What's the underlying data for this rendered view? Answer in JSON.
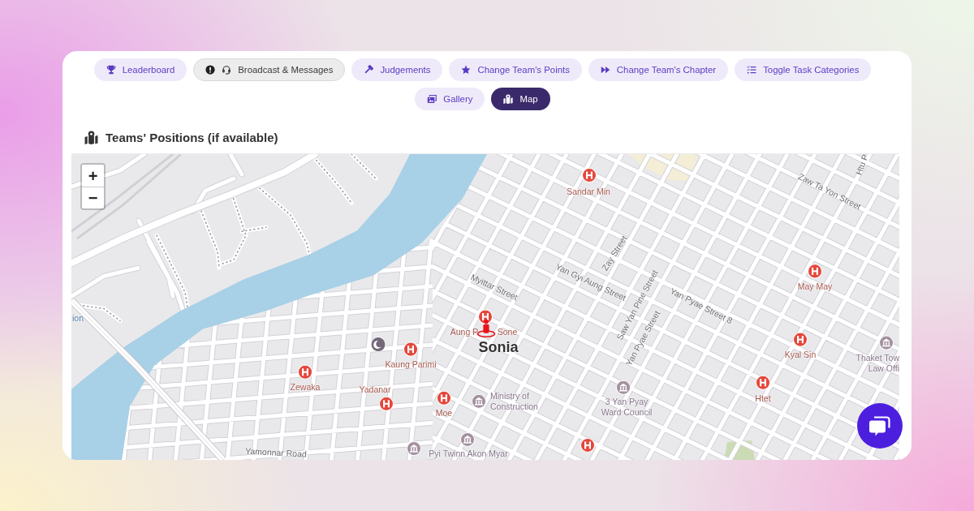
{
  "tabs": [
    {
      "label": "Leaderboard",
      "selected": false,
      "alert": false
    },
    {
      "label": "Broadcast & Messages",
      "selected": false,
      "alert": true
    },
    {
      "label": "Judgements",
      "selected": false,
      "alert": false
    },
    {
      "label": "Change Team's Points",
      "selected": false,
      "alert": false
    },
    {
      "label": "Change Team's Chapter",
      "selected": false,
      "alert": false
    },
    {
      "label": "Toggle Task Categories",
      "selected": false,
      "alert": false
    },
    {
      "label": "Gallery",
      "selected": false,
      "alert": false
    },
    {
      "label": "Map",
      "selected": true,
      "alert": false
    }
  ],
  "panel": {
    "title": "Teams' Positions (if available)"
  },
  "map": {
    "zoom_controls": [
      {
        "label": "+"
      },
      {
        "label": "−"
      }
    ],
    "pois": [
      {
        "kind": "hospital"
      },
      {
        "kind": "hospital"
      },
      {
        "kind": "hospital"
      },
      {
        "kind": "hospital"
      },
      {
        "kind": "hospital"
      },
      {
        "kind": "hospital"
      },
      {
        "kind": "hospital"
      },
      {
        "kind": "hospital"
      },
      {
        "kind": "hospital"
      },
      {
        "kind": "hospital"
      },
      {
        "kind": "office"
      },
      {
        "kind": "office"
      },
      {
        "kind": "office"
      },
      {
        "kind": "office"
      },
      {
        "kind": "office"
      },
      {
        "kind": "landmark"
      }
    ],
    "labels": [
      {
        "kind": "hospital",
        "text": "Sandar Min"
      },
      {
        "kind": "street",
        "text": "Zaw Ta Yon Street"
      },
      {
        "kind": "street",
        "text": "Htu P"
      },
      {
        "kind": "street",
        "text": "Zay Street"
      },
      {
        "kind": "hospital",
        "text": "May May"
      },
      {
        "kind": "street",
        "text": "Myittar Street"
      },
      {
        "kind": "street",
        "text": "Yan Gyi Aung Street"
      },
      {
        "kind": "street",
        "text": "Yan Pyae Street 8"
      },
      {
        "kind": "street",
        "text": "Saw Yan Pine Street"
      },
      {
        "kind": "street",
        "text": "Yan Pyae Street"
      },
      {
        "kind": "district",
        "text": "ion"
      },
      {
        "kind": "hospital",
        "text": "Aung P"
      },
      {
        "kind": "hospital",
        "text": "Sone"
      },
      {
        "kind": "hospital",
        "text": "Kaung Parimi"
      },
      {
        "kind": "hospital",
        "text": "Kyal Sin"
      },
      {
        "kind": "office",
        "text": "Thaket Tow Law Offi"
      },
      {
        "kind": "hospital",
        "text": "Zewaka"
      },
      {
        "kind": "hospital",
        "text": "Yadanar"
      },
      {
        "kind": "office",
        "text": "Ministry of Construction"
      },
      {
        "kind": "office",
        "text": "3 Yan Pyay Ward Council"
      },
      {
        "kind": "hospital",
        "text": "Htet"
      },
      {
        "kind": "hospital",
        "text": "Moe"
      },
      {
        "kind": "office",
        "text": "Pyi Twinn Akon Myar"
      },
      {
        "kind": "street",
        "text": "Yamonnar Road"
      }
    ],
    "team_markers": [
      {
        "name": "Sonia"
      }
    ]
  }
}
